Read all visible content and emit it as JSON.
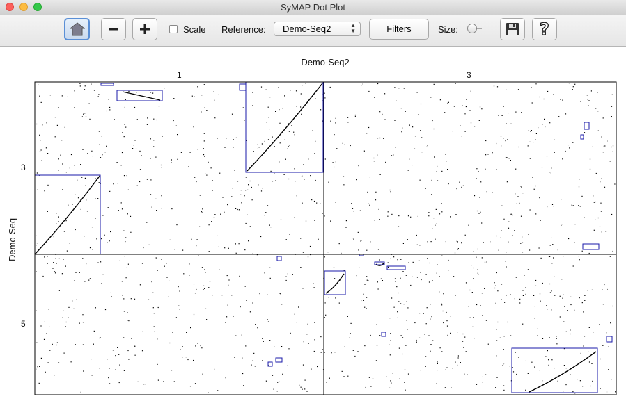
{
  "window": {
    "title": "SyMAP Dot Plot"
  },
  "toolbar": {
    "scale_label": "Scale",
    "reference_label": "Reference:",
    "reference_value": "Demo-Seq2",
    "filters_label": "Filters",
    "size_label": "Size:"
  },
  "plot": {
    "title": "Demo-Seq2",
    "x_chromosomes": [
      "1",
      "3"
    ],
    "y_chromosomes": [
      "3",
      "5"
    ],
    "y_axis_title": "Demo-Seq",
    "dot_color": "#000000",
    "block_color": "#1a1aaa"
  }
}
